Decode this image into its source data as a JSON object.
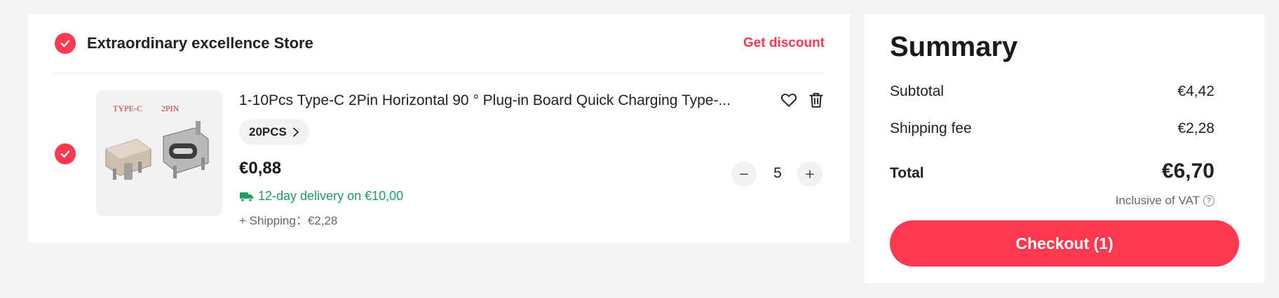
{
  "store": {
    "name": "Extraordinary excellence Store",
    "discount_link": "Get discount"
  },
  "item": {
    "image_labels": [
      "TYPE-C",
      "2PIN"
    ],
    "title": "1-10Pcs Type-C 2Pin Horizontal 90 ° Plug-in Board Quick Charging Type-...",
    "variant": "20PCS",
    "price": "€0,88",
    "delivery": "12-day delivery on €10,00",
    "shipping": "+ Shipping：€2,28",
    "quantity": "5"
  },
  "summary": {
    "title": "Summary",
    "subtotal_label": "Subtotal",
    "subtotal_value": "€4,42",
    "shipping_label": "Shipping fee",
    "shipping_value": "€2,28",
    "total_label": "Total",
    "total_value": "€6,70",
    "vat_note": "Inclusive of VAT",
    "checkout_label": "Checkout (1)"
  },
  "colors": {
    "accent": "#fd384f",
    "delivery_green": "#1e9c64",
    "background": "#f4f4f4"
  },
  "icons": [
    "check-icon",
    "heart-icon",
    "trash-icon",
    "chevron-right-icon",
    "minus-icon",
    "plus-icon",
    "truck-icon",
    "info-icon"
  ]
}
